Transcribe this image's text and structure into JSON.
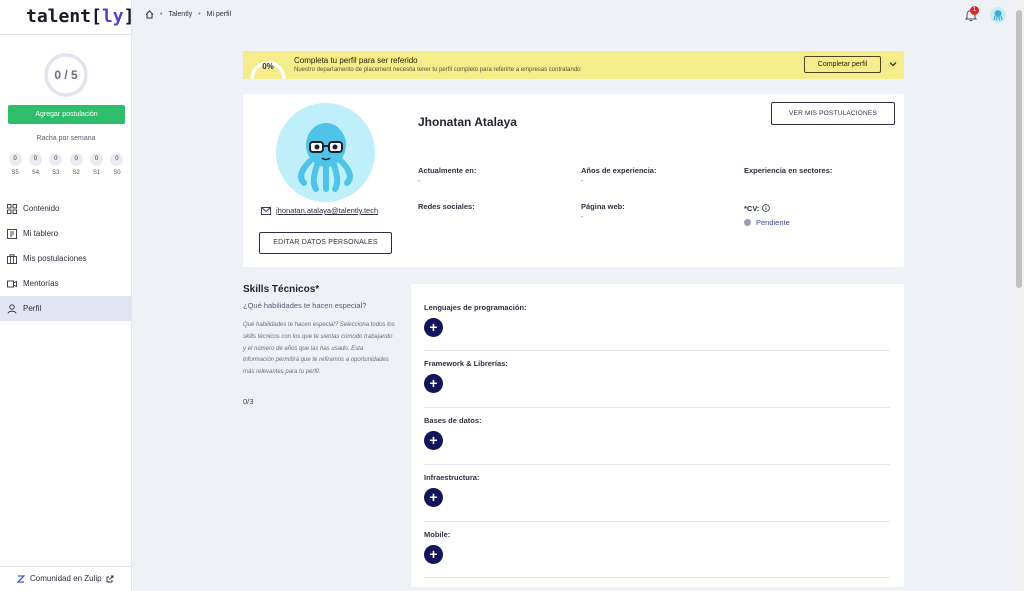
{
  "sidebar": {
    "logo": {
      "prefix": "talent",
      "open": "[",
      "ly": "ly",
      "close": "]"
    },
    "progress": {
      "text": "0 / 5",
      "fraction": 0
    },
    "add_button": "Agregar postulación",
    "streak_title": "Racha por semana",
    "streak": [
      {
        "value": "0",
        "label": "S5"
      },
      {
        "value": "0",
        "label": "S4"
      },
      {
        "value": "0",
        "label": "S3"
      },
      {
        "value": "0",
        "label": "S2"
      },
      {
        "value": "0",
        "label": "S1"
      },
      {
        "value": "0",
        "label": "S0"
      }
    ],
    "nav": [
      {
        "label": "Contenido",
        "icon": "grid-icon"
      },
      {
        "label": "Mi tablero",
        "icon": "board-icon"
      },
      {
        "label": "Mis postulaciones",
        "icon": "briefcase-icon"
      },
      {
        "label": "Mentorías",
        "icon": "video-icon"
      },
      {
        "label": "Perfil",
        "icon": "user-icon",
        "active": true
      }
    ],
    "community": "Comunidad en Zulip"
  },
  "header": {
    "breadcrumb": [
      "Talently",
      "Mi perfil"
    ],
    "notifications": "1"
  },
  "banner": {
    "percent": "0%",
    "title": "Completa tu perfil para ser referido",
    "subtitle": "Nuestro departamento de placement necesita tener tu perfil completo para referirte a empresas contratando",
    "button": "Completar perfil"
  },
  "profile": {
    "name": "Jhonatan Atalaya",
    "email": "jhonatan.atalaya@talently.tech",
    "edit_button": "EDITAR DATOS PERSONALES",
    "posts_button": "VER MIS POSTULACIONES",
    "fields": {
      "current": {
        "label": "Actualmente en:",
        "value": "-"
      },
      "years": {
        "label": "Años de experiencia:",
        "value": "-"
      },
      "sectors": {
        "label": "Experiencia en sectores:",
        "value": ""
      },
      "social": {
        "label": "Redes sociales:",
        "value": ""
      },
      "web": {
        "label": "Página web:",
        "value": "-"
      },
      "cv": {
        "label": "*CV:",
        "status": "Pendiente"
      }
    }
  },
  "skills": {
    "title": "Skills Técnicos*",
    "question": "¿Qué habilidades te hacen especial?",
    "description": "Qué habilidades te hacen especial? Selecciona todos los skills técnicos con los que te sientas cómodo trabajando y el número de años que las has usado. Esta información permitirá que te refiramos a oportunidades más relevantes para tu perfil.",
    "count": "0/3",
    "sections": [
      {
        "label": "Lenguajes de programación:"
      },
      {
        "label": "Framework & Librerías:"
      },
      {
        "label": "Bases de datos:"
      },
      {
        "label": "Infraestructura:"
      },
      {
        "label": "Mobile:"
      }
    ]
  },
  "colors": {
    "accent_green": "#2ebd6b",
    "banner_yellow": "#f6ec8c",
    "navy": "#12155a",
    "avatar_bg": "#bfeffb",
    "octopus": "#4fc3e8"
  }
}
